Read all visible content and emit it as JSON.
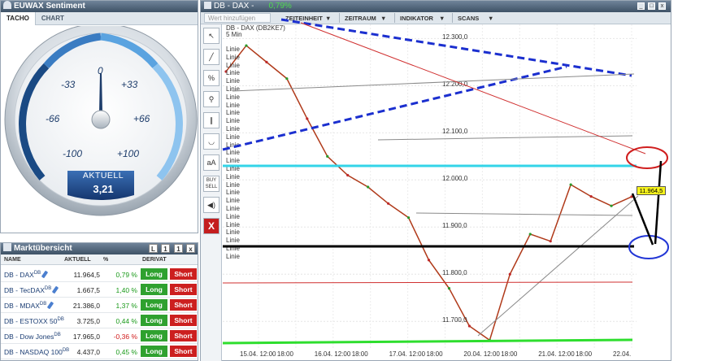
{
  "sentiment": {
    "title": "EUWAX Sentiment",
    "tabs": [
      "TACHO",
      "CHART"
    ],
    "gauge_ticks": [
      "-100",
      "-66",
      "-33",
      "0",
      "+33",
      "+66",
      "+100"
    ],
    "aktuell_label": "AKTUELL",
    "aktuell_value": "3,21"
  },
  "market": {
    "title": "Marktübersicht",
    "head_buttons": [
      "L",
      "1",
      "1",
      "x"
    ],
    "columns": [
      "NAME",
      "AKTUELL",
      "%",
      "DERIVAT"
    ],
    "rows": [
      {
        "name": "DB - DAX",
        "sup": "DB",
        "value": "11.964,5",
        "pct": "0,79 %",
        "pct_color": "#1a9a1a",
        "long": "Long",
        "short": "Short"
      },
      {
        "name": "DB - TecDAX",
        "sup": "DB",
        "value": "1.667,5",
        "pct": "1,40 %",
        "pct_color": "#1a9a1a",
        "long": "Long",
        "short": "Short"
      },
      {
        "name": "DB - MDAX",
        "sup": "DB",
        "value": "21.386,0",
        "pct": "1,37 %",
        "pct_color": "#1a9a1a",
        "long": "Long",
        "short": "Short"
      },
      {
        "name": "DB - ESTOXX 50",
        "sup": "DB",
        "value": "3.725,0",
        "pct": "0,44 %",
        "pct_color": "#1a9a1a",
        "long": "Long",
        "short": "Short"
      },
      {
        "name": "DB - Dow Jones",
        "sup": "DB",
        "value": "17.965,0",
        "pct": "-0,36 %",
        "pct_color": "#d11a1a",
        "long": "Long",
        "short": "Short"
      },
      {
        "name": "DB - NASDAQ 100",
        "sup": "DB",
        "value": "4.437,0",
        "pct": "0,45 %",
        "pct_color": "#1a9a1a",
        "long": "Long",
        "short": "Short"
      }
    ]
  },
  "chart": {
    "title": "DB - DAX -",
    "change": "0,79%",
    "window_buttons": [
      "_",
      "□",
      "x"
    ],
    "search_placeholder": "Wert hinzufügen",
    "menus": [
      "ZEITEINHEIT",
      "ZEITRAUM",
      "INDIKATOR",
      "SCANS"
    ],
    "instrument_label": "DB - DAX (DB2KE7)",
    "interval_label": "5 Min",
    "line_label": "Linie",
    "tools": [
      "cursor",
      "line",
      "percent",
      "zoom",
      "parallel",
      "curve",
      "aA",
      "BUY SELL",
      "sound",
      "X"
    ],
    "price_tag": "11.964,5",
    "yaxis_labels": [
      "12.300,0",
      "12.200,0",
      "12.100,0",
      "12.000,0",
      "11.900,0",
      "11.800,0",
      "11.700,0"
    ],
    "xaxis_labels": [
      "15.04. 12:00",
      "18:00",
      "16.04. 12:00",
      "18:00",
      "17.04. 12:00",
      "18:00",
      "20.04. 12:00",
      "18:00",
      "21.04. 12:00",
      "18:00",
      "22.04."
    ]
  },
  "chart_data": {
    "type": "line",
    "title": "DB - DAX (DB2KE7)",
    "xlabel": "",
    "ylabel": "",
    "ylim": [
      11640,
      12330
    ],
    "grid": true,
    "y_ticks": [
      12300,
      12200,
      12100,
      12000,
      11900,
      11800,
      11700
    ],
    "x": [
      "15.04. 09:00",
      "15.04. 12:00",
      "15.04. 15:00",
      "15.04. 18:00",
      "16.04. 09:00",
      "16.04. 12:00",
      "16.04. 15:00",
      "16.04. 18:00",
      "17.04. 09:00",
      "17.04. 12:00",
      "17.04. 15:00",
      "17.04. 18:00",
      "20.04. 09:00",
      "20.04. 12:00",
      "20.04. 15:00",
      "20.04. 18:00",
      "21.04. 09:00",
      "21.04. 12:00",
      "21.04. 15:00",
      "21.04. 18:00",
      "22.04. 09:00"
    ],
    "series": [
      {
        "name": "DB - DAX (DB2KE7)",
        "values": [
          12230,
          12285,
          12250,
          12215,
          12130,
          12050,
          12010,
          11985,
          11950,
          11920,
          11830,
          11770,
          11690,
          11660,
          11800,
          11885,
          11870,
          11990,
          11965,
          11945,
          11964.5
        ]
      }
    ]
  }
}
